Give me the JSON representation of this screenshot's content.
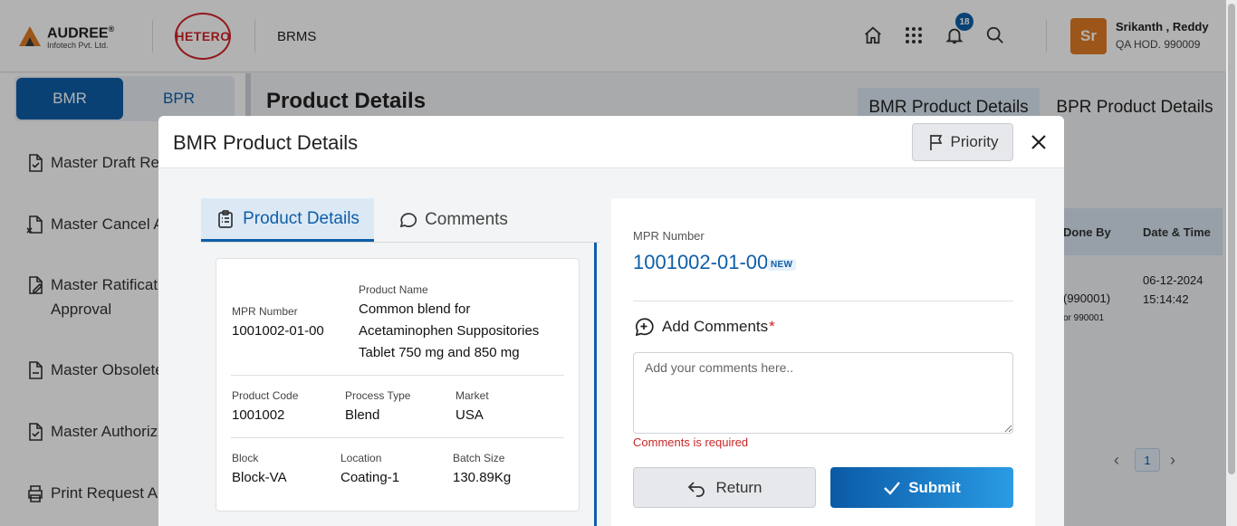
{
  "header": {
    "brand_name": "AUDREE",
    "brand_reg": "®",
    "brand_sub": "Infotech Pvt. Ltd.",
    "partner_logo": "HETERO",
    "app_title": "BRMS",
    "notification_count": "18",
    "user_initials": "Sr",
    "user_name": "Srikanth , Reddy",
    "user_role": "QA HOD. 990009",
    "icons": [
      "home-icon",
      "apps-grid-icon",
      "bell-icon",
      "search-icon"
    ]
  },
  "sidebar": {
    "toggle": [
      "BMR",
      "BPR"
    ],
    "active_toggle": "BMR",
    "items": [
      {
        "label": "Master Draft Rev",
        "icon": "doc-check-icon"
      },
      {
        "label": "Master Cancel A",
        "icon": "doc-cancel-icon"
      },
      {
        "label": "Master Ratificati",
        "label2": "Approval",
        "icon": "doc-edit-icon"
      },
      {
        "label": "Master Obsolete",
        "icon": "doc-minus-icon"
      },
      {
        "label": "Master Authoriz",
        "icon": "doc-check-icon"
      },
      {
        "label": "Print Request A",
        "icon": "printer-icon"
      }
    ]
  },
  "main": {
    "title": "Product Details",
    "tabs": [
      "BMR Product Details",
      "BPR Product Details"
    ],
    "table_headers": [
      "Done By",
      "Date & Time"
    ],
    "row": {
      "done_by": "(990001)",
      "done_by_sub": "or 990001",
      "date": "06-12-2024",
      "time": "15:14:42"
    },
    "page": "1"
  },
  "modal": {
    "title": "BMR Product Details",
    "priority_label": "Priority",
    "tabs": [
      {
        "label": "Product Details",
        "icon": "clipboard-list-icon",
        "active": true
      },
      {
        "label": "Comments",
        "icon": "chat-bubble-icon",
        "active": false
      }
    ],
    "details": {
      "mpr_number_label": "MPR Number",
      "mpr_number": "1001002-01-00",
      "product_name_label": "Product Name",
      "product_name_lines": [
        "Common blend for",
        "Acetaminophen Suppositories",
        "Tablet 750 mg and 850 mg"
      ],
      "product_code_label": "Product Code",
      "product_code": "1001002",
      "process_type_label": "Process Type",
      "process_type": "Blend",
      "market_label": "Market",
      "market": "USA",
      "block_label": "Block",
      "block": "Block-VA",
      "location_label": "Location",
      "location": "Coating-1",
      "batch_size_label": "Batch Size",
      "batch_size": "130.89Kg"
    },
    "comments_panel": {
      "mpr_label": "MPR Number",
      "mpr_value": "1001002-01-00",
      "new_badge": "NEW",
      "add_comments_label": "Add Comments",
      "required_mark": "*",
      "placeholder": "Add your comments here..",
      "error_text": "Comments is required",
      "return_label": "Return",
      "submit_label": "Submit"
    }
  },
  "colors": {
    "primary": "#0e5ea8",
    "accent_orange": "#e07b24",
    "error": "#c62828",
    "hetero_red": "#d2232a"
  }
}
